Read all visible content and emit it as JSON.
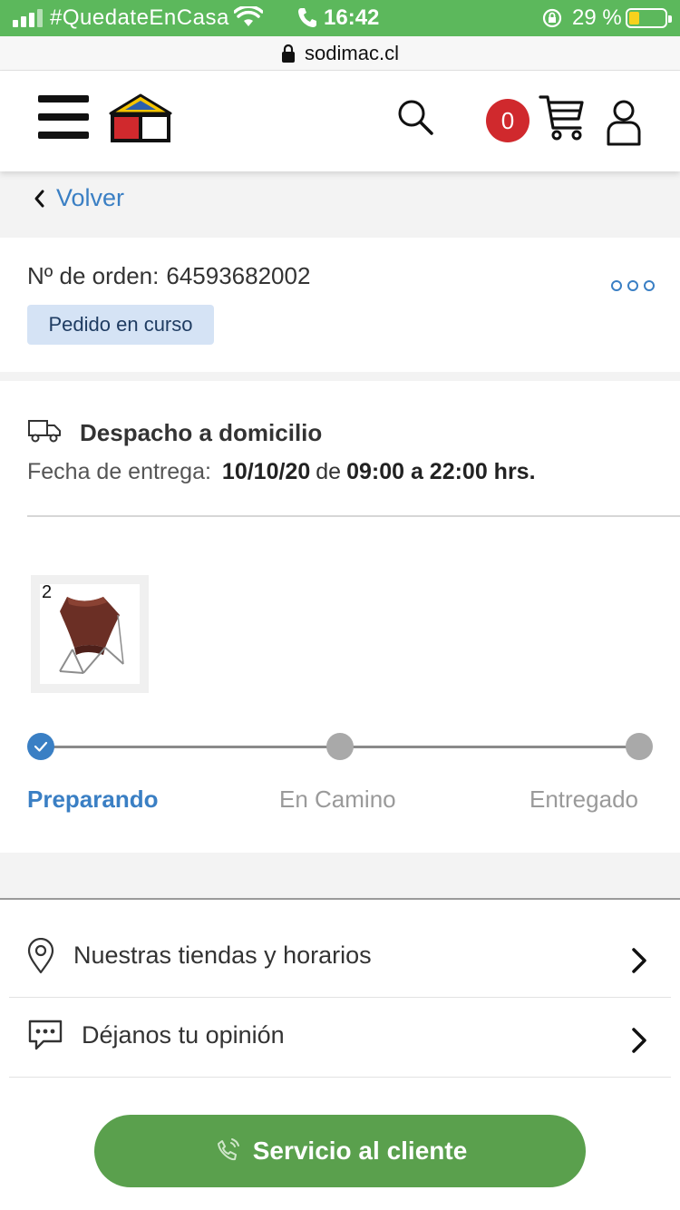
{
  "status_bar": {
    "carrier": "#QuedateEnCasa",
    "time": "16:42",
    "battery": "29 %",
    "battery_level": 0.29
  },
  "url_bar": {
    "url": "sodimac.cl"
  },
  "header": {
    "cart_count": "0",
    "icons": [
      "menu-icon",
      "logo-icon",
      "search-icon",
      "cart-icon",
      "user-icon"
    ]
  },
  "back": {
    "label": "Volver"
  },
  "order": {
    "number_label": "Nº de orden:",
    "number": "64593682002",
    "status": "Pedido en curso"
  },
  "delivery": {
    "title": "Despacho a domicilio",
    "date_label": "Fecha de entrega:",
    "date": "10/10/20",
    "connector": "de",
    "hours": "09:00 a 22:00 hrs.",
    "product_qty": "2"
  },
  "progress": {
    "steps": [
      "Preparando",
      "En Camino",
      "Entregado"
    ],
    "current_step": 1
  },
  "menu": {
    "stores": "Nuestras tiendas y horarios",
    "feedback": "Déjanos tu opinión"
  },
  "cta": {
    "label": "Servicio al cliente"
  },
  "colors": {
    "accent_green": "#5cb85c",
    "link_blue": "#3a7fc4",
    "badge_red": "#d0292d",
    "cta_green": "#5aa04d"
  }
}
